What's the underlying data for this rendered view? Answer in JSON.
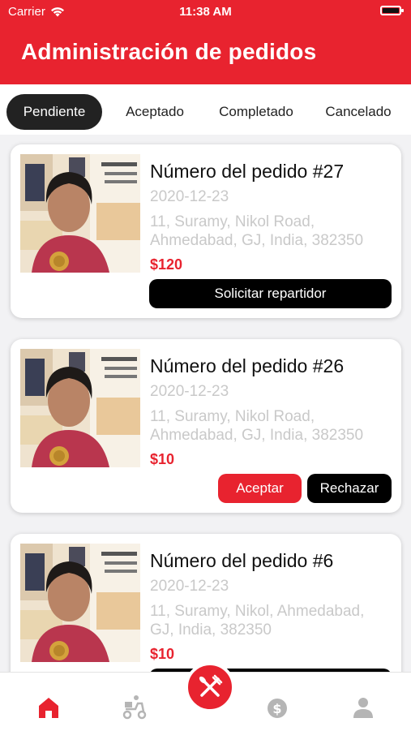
{
  "status_bar": {
    "carrier": "Carrier",
    "time": "11:38 AM"
  },
  "header": {
    "title": "Administración de pedidos"
  },
  "tabs": [
    {
      "label": "Pendiente",
      "active": true
    },
    {
      "label": "Aceptado",
      "active": false
    },
    {
      "label": "Completado",
      "active": false
    },
    {
      "label": "Cancelado",
      "active": false
    }
  ],
  "orders": [
    {
      "title": "Número del pedido #27",
      "date": "2020-12-23",
      "address": "11, Suramy, Nikol Road, Ahmedabad, GJ, India, 382350",
      "price": "$120",
      "buttons": [
        {
          "label": "Solicitar repartidor",
          "style": "black"
        }
      ]
    },
    {
      "title": "Número del pedido #26",
      "date": "2020-12-23",
      "address": "11, Suramy, Nikol Road, Ahmedabad, GJ, India, 382350",
      "price": "$10",
      "buttons": [
        {
          "label": "Aceptar",
          "style": "red"
        },
        {
          "label": "Rechazar",
          "style": "black"
        }
      ]
    },
    {
      "title": "Número del pedido #6",
      "date": "2020-12-23",
      "address": "11, Suramy, Nikol, Ahmedabad, GJ, India, 382350",
      "price": "$10",
      "buttons": []
    }
  ],
  "bottom_nav": [
    {
      "icon": "home-icon",
      "active": true
    },
    {
      "icon": "delivery-scooter-icon",
      "active": false
    },
    {
      "icon": "fork-knife-icon",
      "active": false
    },
    {
      "icon": "dollar-coin-icon",
      "active": false
    },
    {
      "icon": "user-icon",
      "active": false
    }
  ],
  "colors": {
    "accent": "#e8232f",
    "dark": "#000000",
    "muted_text": "#c9c9c9",
    "inactive_icon": "#b5b5b5"
  }
}
